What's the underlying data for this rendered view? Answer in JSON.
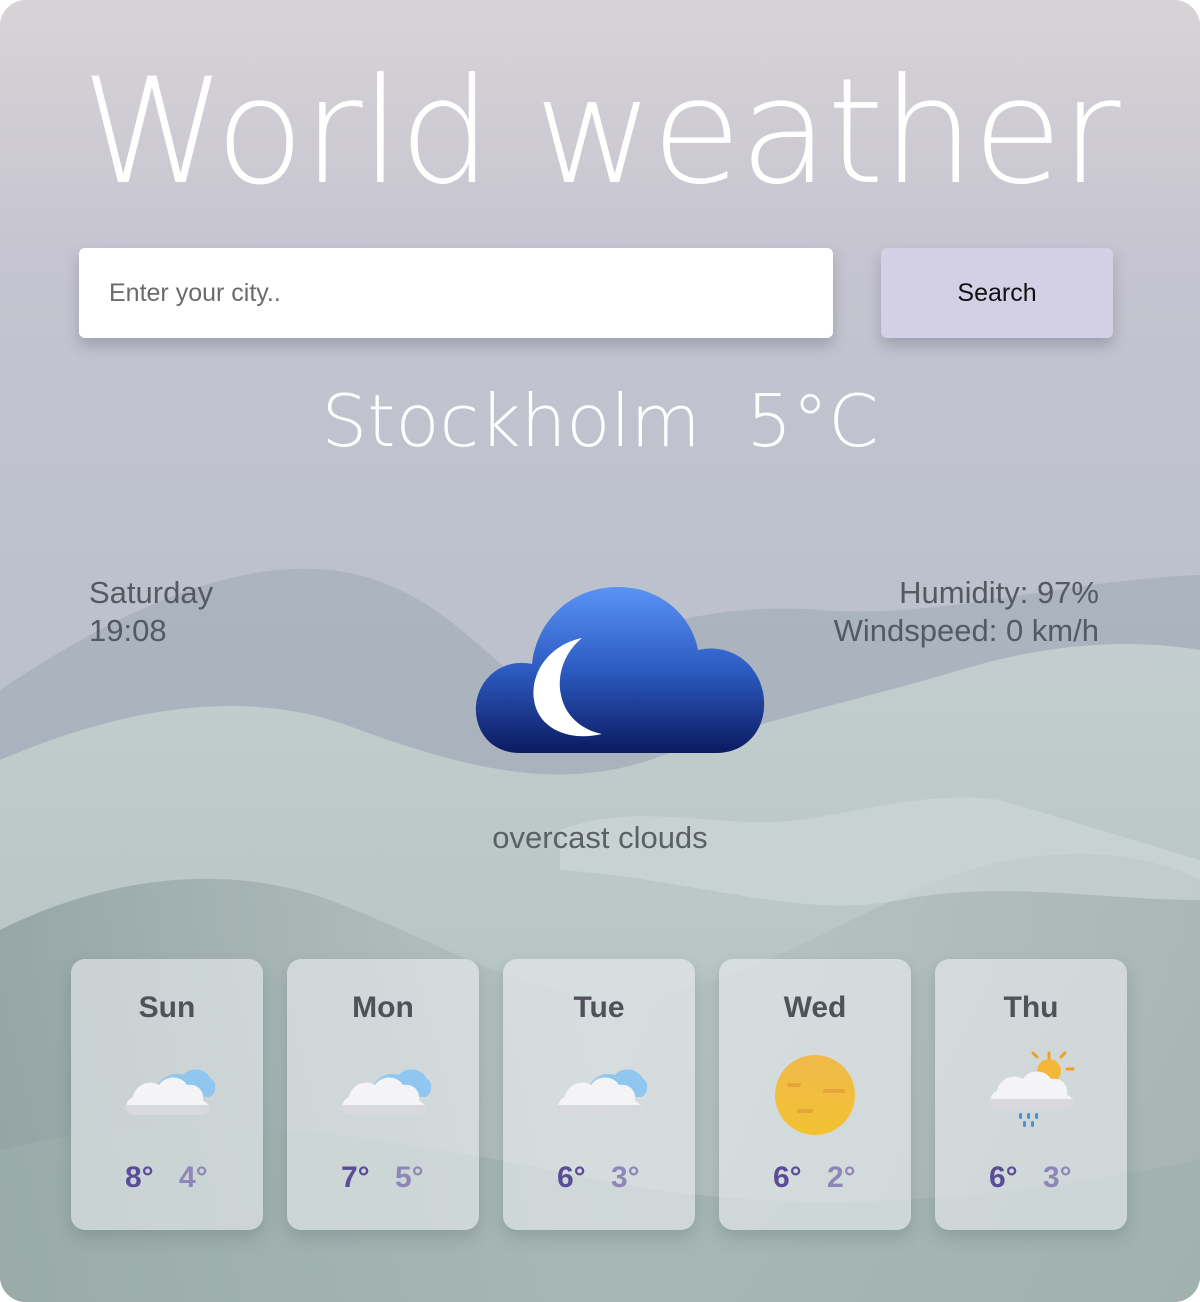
{
  "app": {
    "title": "World weather"
  },
  "search": {
    "placeholder": "Enter your city..",
    "value": "",
    "button_label": "Search"
  },
  "current": {
    "headline": "Stockholm  5°C",
    "day": "Saturday",
    "time": "19:08",
    "humidity": "Humidity: 97%",
    "windspeed": "Windspeed: 0 km/h",
    "description": "overcast clouds",
    "icon": "cloud-moon-icon"
  },
  "forecast": [
    {
      "day": "Sun",
      "high": "8°",
      "low": "4°",
      "icon": "cloud-icon"
    },
    {
      "day": "Mon",
      "high": "7°",
      "low": "5°",
      "icon": "cloud-icon"
    },
    {
      "day": "Tue",
      "high": "6°",
      "low": "3°",
      "icon": "cloud-icon"
    },
    {
      "day": "Wed",
      "high": "6°",
      "low": "2°",
      "icon": "sun-icon"
    },
    {
      "day": "Thu",
      "high": "6°",
      "low": "3°",
      "icon": "sun-cloud-rain-icon"
    }
  ],
  "colors": {
    "high_temp": "#5b4c98",
    "low_temp": "#8f86b8",
    "search_button": "#d3d0e5",
    "icon_cloud_top": "#5a93f5",
    "icon_cloud_bottom": "#0c1a60"
  }
}
